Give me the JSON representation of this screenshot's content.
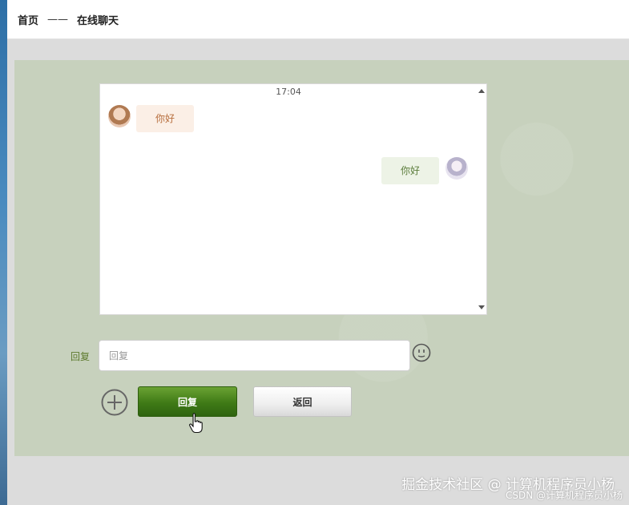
{
  "breadcrumb": {
    "home": "首页",
    "separator": "——",
    "current": "在线聊天"
  },
  "chat": {
    "timestamp": "17:04",
    "messages": [
      {
        "side": "received",
        "text": "你好"
      },
      {
        "side": "sent",
        "text": "你好"
      }
    ]
  },
  "reply": {
    "label": "回复",
    "placeholder": "回复",
    "value": ""
  },
  "buttons": {
    "reply": "回复",
    "back": "返回"
  },
  "icons": {
    "emoji": "smiley-face-icon",
    "add": "plus-circle-icon",
    "cursor": "hand-pointer-icon"
  },
  "colors": {
    "accent_green": "#3f7a16",
    "stage_background": "#c7d1bd",
    "received_bubble": "#fbefe6",
    "sent_bubble": "#edf3e6"
  },
  "watermark": {
    "main": "掘金技术社区 @ 计算机程序员小杨",
    "sub": "CSDN @计算机程序员小杨"
  }
}
